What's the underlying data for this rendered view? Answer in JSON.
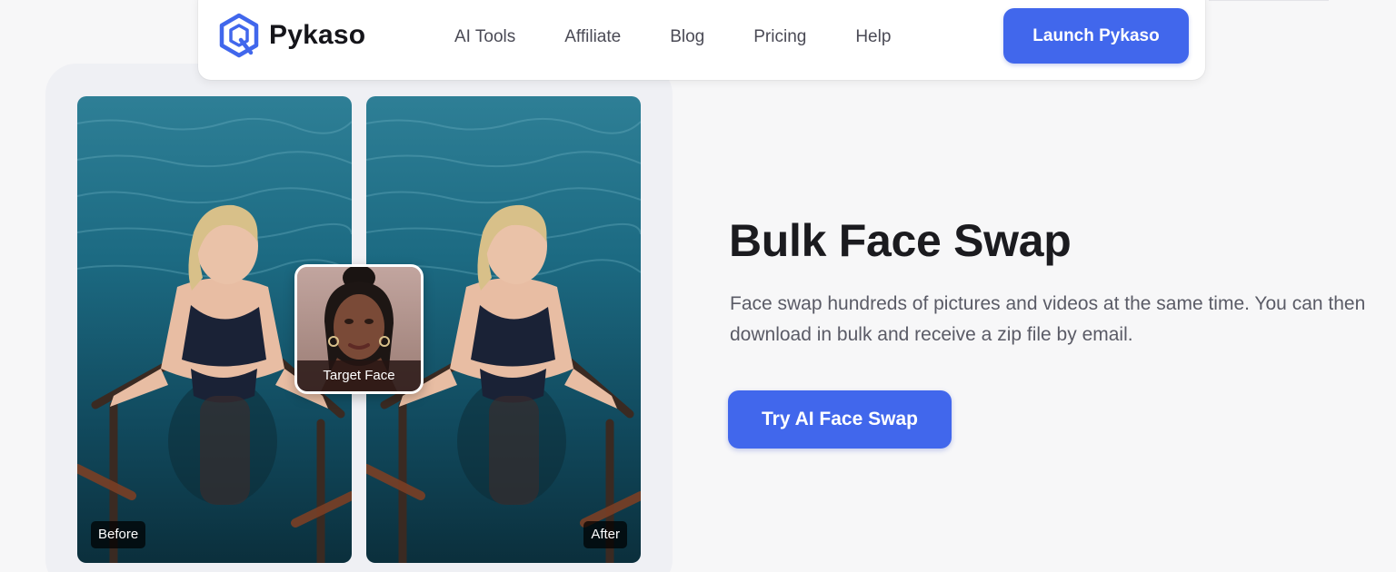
{
  "brand": {
    "name": "Pykaso",
    "accent": "#4167ec",
    "logo_icon": "hexagon-logo-icon"
  },
  "nav": {
    "links": [
      "AI Tools",
      "Affiliate",
      "Blog",
      "Pricing",
      "Help"
    ],
    "launch_label": "Launch Pykaso"
  },
  "showcase": {
    "before_label": "Before",
    "after_label": "After",
    "target_label": "Target Face"
  },
  "hero": {
    "title": "Bulk Face Swap",
    "description": "Face swap hundreds of pictures and videos at the same time. You can then download in bulk and receive a zip file by email.",
    "cta_label": "Try AI Face Swap"
  }
}
